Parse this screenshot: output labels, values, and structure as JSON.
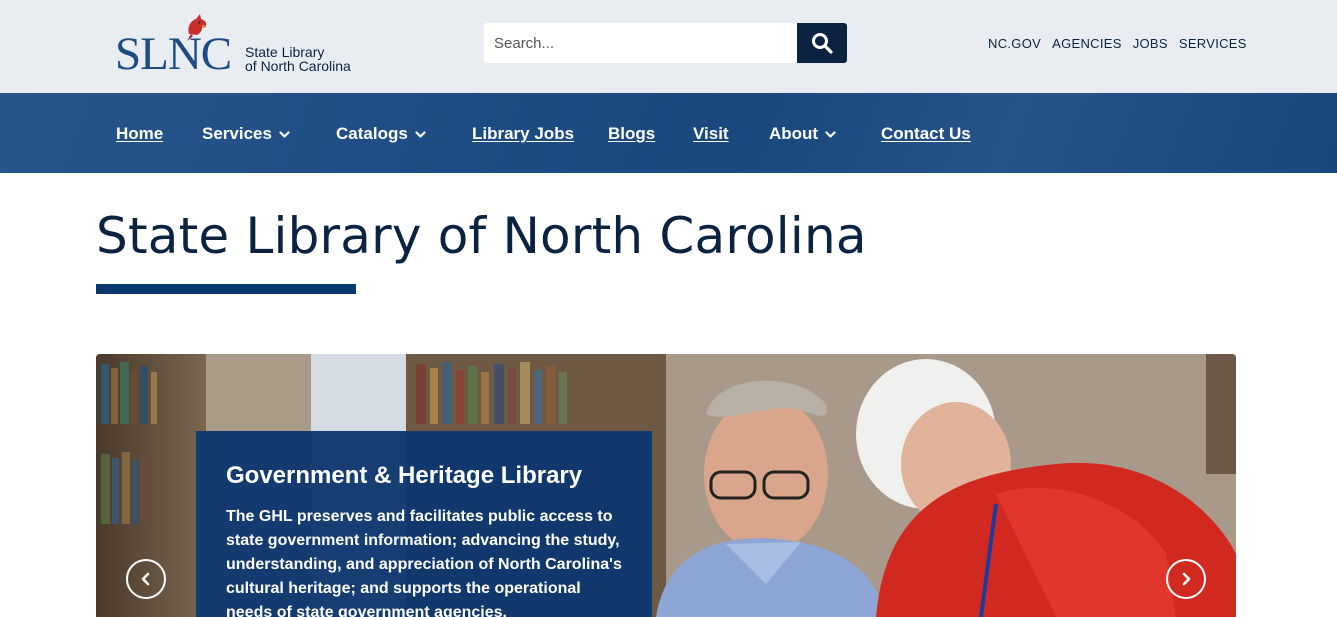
{
  "header": {
    "logo_mark": "SLNC",
    "logo_line1": "State Library",
    "logo_line2": "of North Carolina",
    "search_placeholder": "Search...",
    "utility_links": [
      "NC.GOV",
      "AGENCIES",
      "JOBS",
      "SERVICES"
    ]
  },
  "nav": {
    "items": [
      {
        "label": "Home",
        "dropdown": false
      },
      {
        "label": "Services",
        "dropdown": true
      },
      {
        "label": "Catalogs",
        "dropdown": true
      },
      {
        "label": "Library Jobs",
        "dropdown": false
      },
      {
        "label": "Blogs",
        "dropdown": false
      },
      {
        "label": "Visit",
        "dropdown": false
      },
      {
        "label": "About",
        "dropdown": true
      },
      {
        "label": "Contact Us",
        "dropdown": false
      }
    ]
  },
  "page": {
    "title": "State Library of North Carolina"
  },
  "carousel": {
    "slide_title": "Government & Heritage Library",
    "slide_text": "The GHL preserves and facilitates public access to state government information; advancing the study, understanding, and appreciation of North Carolina's cultural heritage; and supports the operational needs of state government agencies."
  },
  "colors": {
    "topbar_bg": "#e9edf1",
    "nav_bg": "#1a4a83",
    "brand_dark": "#0b2341",
    "accent_red": "#c8302c"
  }
}
